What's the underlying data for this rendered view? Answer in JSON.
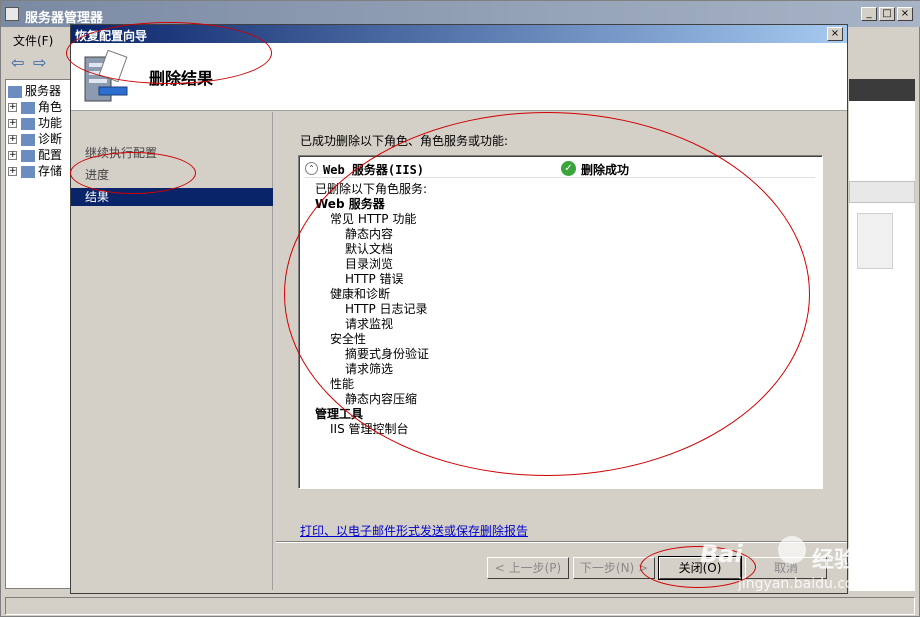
{
  "server_manager": {
    "title": "服务器管理器",
    "menu_file": "文件(F)",
    "tree": [
      "服务器",
      "角色",
      "功能",
      "诊断",
      "配置",
      "存储"
    ]
  },
  "dialog": {
    "title": "恢复配置向导",
    "header_title": "删除结果",
    "close_glyph": "×",
    "nav": [
      "继续执行配置",
      "进度",
      "结果"
    ],
    "caption": "已成功删除以下角色、角色服务或功能:",
    "result_role": "Web 服务器(IIS)",
    "result_status": "删除成功",
    "result_lines": [
      {
        "text": "已删除以下角色服务:",
        "level": 1,
        "bold": false
      },
      {
        "text": "Web 服务器",
        "level": 1,
        "bold": true
      },
      {
        "text": "常见 HTTP 功能",
        "level": 2,
        "bold": false
      },
      {
        "text": "静态内容",
        "level": 3,
        "bold": false
      },
      {
        "text": "默认文档",
        "level": 3,
        "bold": false
      },
      {
        "text": "目录浏览",
        "level": 3,
        "bold": false
      },
      {
        "text": "HTTP 错误",
        "level": 3,
        "bold": false
      },
      {
        "text": "健康和诊断",
        "level": 2,
        "bold": false
      },
      {
        "text": "HTTP 日志记录",
        "level": 3,
        "bold": false
      },
      {
        "text": "请求监视",
        "level": 3,
        "bold": false
      },
      {
        "text": "安全性",
        "level": 2,
        "bold": false
      },
      {
        "text": "摘要式身份验证",
        "level": 3,
        "bold": false
      },
      {
        "text": "请求筛选",
        "level": 3,
        "bold": false
      },
      {
        "text": "性能",
        "level": 2,
        "bold": false
      },
      {
        "text": "静态内容压缩",
        "level": 3,
        "bold": false
      },
      {
        "text": "管理工具",
        "level": 1,
        "bold": true
      },
      {
        "text": "IIS 管理控制台",
        "level": 2,
        "bold": false
      }
    ],
    "report_link": "打印、以电子邮件形式发送或保存删除报告",
    "buttons": {
      "prev": "< 上一步(P)",
      "next": "下一步(N) >",
      "close": "关闭(O)",
      "cancel": "取消"
    }
  },
  "watermark": {
    "brand": "Bai",
    "brand2": "经验",
    "site": "jingyan.baidu.com"
  },
  "colors": {
    "dialog_title_bar": "#0a246a",
    "nav_active": "#0a246a",
    "annotation": "#d00000",
    "success": "#3aa53a",
    "link": "#0000cc"
  }
}
